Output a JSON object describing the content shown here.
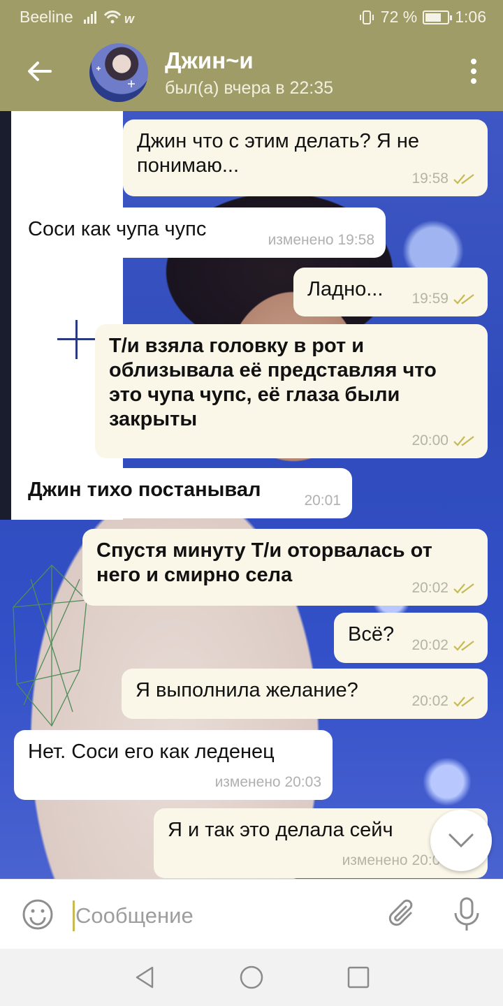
{
  "status_bar": {
    "carrier": "Beeline",
    "battery": "72 %",
    "battery_level": 0.72,
    "time": "1:06"
  },
  "header": {
    "title": "Джин~и",
    "subtitle": "был(а) вчера в 22:35"
  },
  "messages": [
    {
      "side": "out",
      "text": "Джин что с этим делать? Я не понимаю...",
      "time": "19:58",
      "edited": "",
      "read": true
    },
    {
      "side": "in",
      "text": "Соси как чупа чупс",
      "time": "изменено 19:58",
      "read": false
    },
    {
      "side": "out",
      "text": "Ладно...",
      "time": "19:59",
      "read": true
    },
    {
      "side": "out",
      "text": "Т/и взяла головку в рот и облизывала её представляя что это чупа чупс, её глаза были закрыты",
      "time": "20:00",
      "read": true
    },
    {
      "side": "in",
      "text": "Джин тихо постанывал",
      "time": "20:01",
      "read": false
    },
    {
      "side": "out",
      "text": "Спустя минуту Т/и оторвалась от него и смирно села",
      "time": "20:02",
      "read": true
    },
    {
      "side": "out",
      "text": "Всё?",
      "time": "20:02",
      "read": true
    },
    {
      "side": "out",
      "text": "Я выполнила желание?",
      "time": "20:02",
      "read": true
    },
    {
      "side": "in",
      "text": "Нет. Соси его как леденец",
      "time": "изменено 20:03",
      "read": false
    },
    {
      "side": "out",
      "text": "Я и так это делала сейч",
      "time": "изменено 20:03",
      "read": true
    }
  ],
  "input": {
    "placeholder": "Сообщение"
  },
  "colors": {
    "header_bg": "#a09c68",
    "outgoing_bubble": "#fbf7e8",
    "incoming_bubble": "#ffffff",
    "check": "#c6ba55"
  },
  "icons": [
    "back-arrow-icon",
    "more-vert-icon",
    "emoji-icon",
    "attach-icon",
    "mic-icon",
    "chevron-down-icon",
    "back-triangle-icon",
    "home-circle-icon",
    "recents-square-icon"
  ]
}
